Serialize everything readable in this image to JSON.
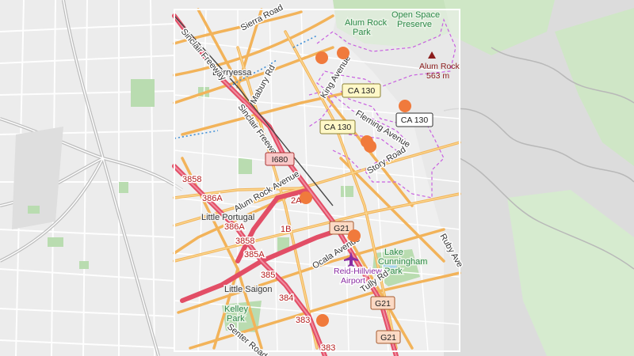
{
  "map": {
    "place_labels": {
      "berryessa": "Berryessa",
      "little_portugal": "Little Portugal",
      "little_saigon": "Little Saigon"
    },
    "park_labels": {
      "alum_rock_park_l1": "Alum Rock",
      "alum_rock_park_l2": "Park",
      "open_space_l1": "Open Space",
      "open_space_l2": "Preserve",
      "lake_cunningham_l1": "Lake",
      "lake_cunningham_l2": "Cunningham",
      "lake_cunningham_l3": "Park",
      "kelley_l1": "Kelley",
      "kelley_l2": "Park"
    },
    "peak": {
      "name": "Alum Rock",
      "elevation": "563 m"
    },
    "airport": {
      "line1": "Reid-Hillview",
      "line2": "Airport"
    },
    "street_labels": {
      "sierra_road": "Sierra Road",
      "sinclair_freeway_nw": "Sinclair Freeway",
      "mabury_rd": "Mabury Rd",
      "sinclair_freeway_mid": "Sinclair Freeway",
      "king_avenue": "King Avenue",
      "fleming_avenue": "Fleming Avenue",
      "story_road": "Story Road",
      "alum_rock_avenue": "Alum Rock Avenue",
      "ruby_ave": "Ruby Ave",
      "ocala_avenue": "Ocala Avenue",
      "tully_rd": "Tully Rd",
      "senter_road": "Senter Road"
    },
    "route_labels": {
      "r3858_top": "3858",
      "r386a_top": "386A",
      "r386a_bottom": "386A",
      "r2a": "2A",
      "r1b": "1B",
      "r3858_bottom": "3858",
      "r385a": "385A",
      "r385": "385",
      "r384": "384",
      "r383_top": "383",
      "r383_bottom": "383"
    },
    "shields": {
      "ca130_top": "CA 130",
      "ca130_right": "CA 130",
      "ca130_left": "CA 130",
      "i680": "I680",
      "g21_top": "G21",
      "g21_mid": "G21",
      "g21_bottom": "G21"
    },
    "markers": {
      "count": 8
    }
  },
  "colors": {
    "background": "#e9e9e9",
    "park": "#b9dcb0",
    "arterial": "#f6c46a",
    "highway": "#e0506a",
    "marker": "#f07a3c",
    "boundary": "#c860e0",
    "water": "#4aa0e0",
    "viewport": "#ffffff"
  }
}
